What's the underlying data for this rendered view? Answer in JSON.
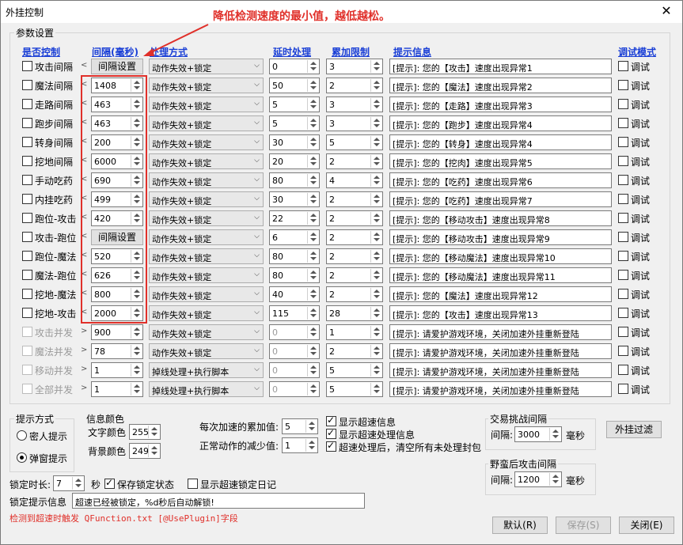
{
  "window": {
    "title": "外挂控制",
    "close": "✕"
  },
  "annotation": "降低检测速度的最小值，越低越松。",
  "param_group": "参数设置",
  "headers": {
    "enable": "是否控制",
    "interval": "间隔(毫秒)",
    "method": "处理方式",
    "delay": "延时处理",
    "limit": "累加限制",
    "hint": "提示信息",
    "debug": "调试模式"
  },
  "rows": [
    {
      "name": "攻击间隔",
      "checked": false,
      "enabled": true,
      "arrow": "<",
      "interval": "",
      "interval_button": "间隔设置",
      "method": "动作失效+锁定",
      "delay": "0",
      "limit": "3",
      "hint": "[提示]: 您的【攻击】速度出现异常1",
      "debug": "调试"
    },
    {
      "name": "魔法间隔",
      "checked": false,
      "enabled": true,
      "arrow": "<",
      "interval": "1408",
      "method": "动作失效+锁定",
      "delay": "50",
      "limit": "2",
      "hint": "[提示]: 您的【魔法】速度出现异常2",
      "debug": "调试"
    },
    {
      "name": "走路间隔",
      "checked": false,
      "enabled": true,
      "arrow": "<",
      "interval": "463",
      "method": "动作失效+锁定",
      "delay": "5",
      "limit": "3",
      "hint": "[提示]: 您的【走路】速度出现异常3",
      "debug": "调试"
    },
    {
      "name": "跑步间隔",
      "checked": false,
      "enabled": true,
      "arrow": "<",
      "interval": "463",
      "method": "动作失效+锁定",
      "delay": "5",
      "limit": "3",
      "hint": "[提示]: 您的【跑步】速度出现异常4",
      "debug": "调试"
    },
    {
      "name": "转身间隔",
      "checked": false,
      "enabled": true,
      "arrow": "<",
      "interval": "200",
      "method": "动作失效+锁定",
      "delay": "30",
      "limit": "5",
      "hint": "[提示]: 您的【转身】速度出现异常4",
      "debug": "调试"
    },
    {
      "name": "挖地间隔",
      "checked": false,
      "enabled": true,
      "arrow": "<",
      "interval": "6000",
      "method": "动作失效+锁定",
      "delay": "20",
      "limit": "2",
      "hint": "[提示]: 您的【挖肉】速度出现异常5",
      "debug": "调试"
    },
    {
      "name": "手动吃药",
      "checked": false,
      "enabled": true,
      "arrow": "<",
      "interval": "690",
      "method": "动作失效+锁定",
      "delay": "80",
      "limit": "4",
      "hint": "[提示]: 您的【吃药】速度出现异常6",
      "debug": "调试"
    },
    {
      "name": "内挂吃药",
      "checked": false,
      "enabled": true,
      "arrow": "<",
      "interval": "499",
      "method": "动作失效+锁定",
      "delay": "30",
      "limit": "2",
      "hint": "[提示]: 您的【吃药】速度出现异常7",
      "debug": "调试"
    },
    {
      "name": "跑位-攻击",
      "checked": false,
      "enabled": true,
      "arrow": "<",
      "interval": "420",
      "method": "动作失效+锁定",
      "delay": "22",
      "limit": "2",
      "hint": "[提示]: 您的【移动攻击】速度出现异常8",
      "debug": "调试"
    },
    {
      "name": "攻击-跑位",
      "checked": false,
      "enabled": true,
      "arrow": "<",
      "interval": "",
      "interval_button": "间隔设置",
      "method": "动作失效+锁定",
      "delay": "6",
      "limit": "2",
      "hint": "[提示]: 您的【移动攻击】速度出现异常9",
      "debug": "调试"
    },
    {
      "name": "跑位-魔法",
      "checked": false,
      "enabled": true,
      "arrow": "<",
      "interval": "520",
      "method": "动作失效+锁定",
      "delay": "80",
      "limit": "2",
      "hint": "[提示]: 您的【移动魔法】速度出现异常10",
      "debug": "调试"
    },
    {
      "name": "魔法-跑位",
      "checked": false,
      "enabled": true,
      "arrow": "<",
      "interval": "626",
      "method": "动作失效+锁定",
      "delay": "80",
      "limit": "2",
      "hint": "[提示]: 您的【移动魔法】速度出现异常11",
      "debug": "调试"
    },
    {
      "name": "挖地-魔法",
      "checked": false,
      "enabled": true,
      "arrow": "<",
      "interval": "800",
      "method": "动作失效+锁定",
      "delay": "40",
      "limit": "2",
      "hint": "[提示]: 您的【魔法】速度出现异常12",
      "debug": "调试"
    },
    {
      "name": "挖地-攻击",
      "checked": false,
      "enabled": true,
      "arrow": "<",
      "interval": "2000",
      "method": "动作失效+锁定",
      "delay": "115",
      "limit": "28",
      "hint": "[提示]: 您的【攻击】速度出现异常13",
      "debug": "调试"
    },
    {
      "name": "攻击并发",
      "checked": false,
      "enabled": false,
      "arrow": ">",
      "interval": "900",
      "method": "动作失效+锁定",
      "delay": "0",
      "limit": "1",
      "hint": "[提示]: 请爱护游戏环境，关闭加速外挂重新登陆",
      "debug": "调试"
    },
    {
      "name": "魔法并发",
      "checked": false,
      "enabled": false,
      "arrow": ">",
      "interval": "78",
      "method": "动作失效+锁定",
      "delay": "0",
      "limit": "2",
      "hint": "[提示]: 请爱护游戏环境，关闭加速外挂重新登陆",
      "debug": "调试"
    },
    {
      "name": "移动并发",
      "checked": false,
      "enabled": false,
      "arrow": ">",
      "interval": "1",
      "method": "掉线处理+执行脚本",
      "delay": "0",
      "limit": "5",
      "hint": "[提示]: 请爱护游戏环境，关闭加速外挂重新登陆",
      "debug": "调试"
    },
    {
      "name": "全部并发",
      "checked": false,
      "enabled": false,
      "arrow": ">",
      "interval": "1",
      "method": "掉线处理+执行脚本",
      "delay": "0",
      "limit": "5",
      "hint": "[提示]: 请爱护游戏环境，关闭加速外挂重新登陆",
      "debug": "调试"
    }
  ],
  "hint_mode": {
    "label": "提示方式",
    "options": [
      "密人提示",
      "弹窗提示"
    ],
    "selected": 1
  },
  "info_color": {
    "label": "信息颜色",
    "text_label": "文字颜色",
    "text_value": "255",
    "bg_label": "背景颜色",
    "bg_value": "249"
  },
  "accum": {
    "add_label": "每次加速的累加值:",
    "add_value": "5",
    "sub_label": "正常动作的减少值:",
    "sub_value": "1"
  },
  "options": [
    {
      "label": "显示超速信息",
      "checked": true
    },
    {
      "label": "显示超速处理信息",
      "checked": true
    },
    {
      "label": "超速处理后，清空所有未处理封包",
      "checked": true
    }
  ],
  "trade": {
    "label": "交易挑战间隔",
    "interval_label": "间隔:",
    "value": "3000",
    "unit": "毫秒"
  },
  "beast": {
    "label": "野蛮后攻击间隔",
    "interval_label": "间隔:",
    "value": "1200",
    "unit": "毫秒"
  },
  "filter_button": "外挂过滤",
  "lock": {
    "label": "锁定时长:",
    "value": "7",
    "unit": "秒",
    "save_state": "保存锁定状态",
    "save_checked": true,
    "show_log": "显示超速锁定日记",
    "log_checked": false
  },
  "lock_hint": {
    "label": "锁定提示信息",
    "value": "超速已经被锁定，%d秒后自动解锁!"
  },
  "trigger_text": "检测到超速时触发 QFunction.txt [@UsePlugin]字段",
  "buttons": {
    "default": "默认(R)",
    "save": "保存(S)",
    "close": "关闭(E)"
  },
  "colors": {
    "header": "#1a3fd6",
    "annotation": "#e0302a"
  }
}
